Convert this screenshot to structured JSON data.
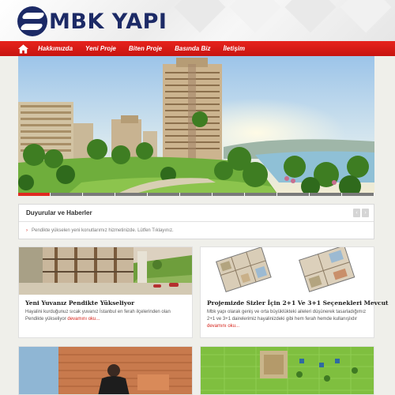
{
  "brand": {
    "name": "MBK YAPI",
    "color": "#1c2a66",
    "accent": "#e0221b"
  },
  "nav": {
    "home_icon": "home-icon",
    "items": [
      "Hakkımızda",
      "Yeni Proje",
      "Biten Proje",
      "Basında Biz",
      "İletişim"
    ]
  },
  "slider": {
    "slide_count": 11,
    "active_slide": 1
  },
  "news": {
    "title": "Duyurular ve Haberler",
    "items": [
      "Pendikte yükselen yeni konutlarımız hizmetinizde. Lütfen Tıklayınız."
    ],
    "prev_icon": "chevron-left-icon",
    "next_icon": "chevron-right-icon"
  },
  "cards": [
    {
      "title": "Yeni Yuvanız Pendikte Yükseliyor",
      "body": "Hayalini kurduğunuz sıcak yuvanız İstanbul en ferah ilçelerinden olan Pendikte yükseliyor",
      "more": "devamını oku..."
    },
    {
      "title": "Projemizde Sizler İçin 2+1 Ve 3+1 Seçenekleri Mevcut",
      "body": "Mbk yapı olarak geniş ve orta büyüklükteki aileleri düşünerek tasarladığımız 2+1 ve 3+1 dairelerimiz hayalinizdeki gibi hem ferah hemde kullanışlıdır",
      "more": "devamını oku..."
    }
  ]
}
